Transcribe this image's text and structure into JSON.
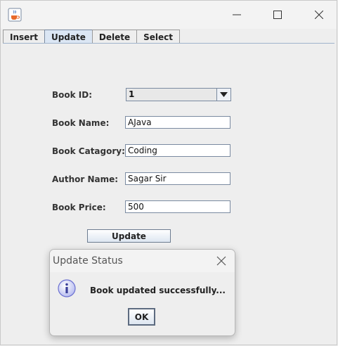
{
  "window": {
    "icons": {
      "app": "java-cup-icon",
      "minimize": "minimize-icon",
      "maximize": "maximize-icon",
      "close": "close-icon"
    }
  },
  "tabs": [
    {
      "label": "Insert",
      "active": false
    },
    {
      "label": "Update",
      "active": true
    },
    {
      "label": "Delete",
      "active": false
    },
    {
      "label": "Select",
      "active": false
    }
  ],
  "form": {
    "book_id_label": "Book ID:",
    "book_id_value": "1",
    "book_name_label": "Book Name:",
    "book_name_value": "AJava",
    "book_category_label": "Book Catagory:",
    "book_category_value": "Coding",
    "author_name_label": "Author Name:",
    "author_name_value": "Sagar Sir",
    "book_price_label": "Book Price:",
    "book_price_value": "500",
    "update_label": "Update"
  },
  "dialog": {
    "title": "Update Status",
    "message": "Book updated successfully...",
    "ok_label": "OK",
    "icon": "info-icon"
  },
  "colors": {
    "background": "#eeeeee",
    "active_tab": "#dbe6f4",
    "field_border": "#7a8aa0",
    "info_icon": "#6a6fd0"
  }
}
